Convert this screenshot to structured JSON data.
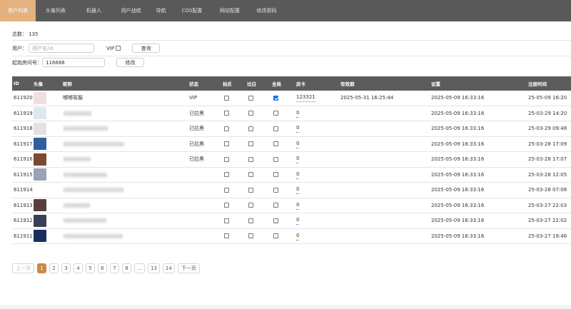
{
  "nav": [
    {
      "label": "用户列表",
      "active": true
    },
    {
      "label": "头像列表",
      "active": false
    },
    {
      "label": "机器人",
      "active": false
    },
    {
      "label": "用户战绩",
      "active": false
    },
    {
      "label": "导航",
      "active": false
    },
    {
      "label": "COS配置",
      "active": false
    },
    {
      "label": "网站配置",
      "active": false
    },
    {
      "label": "修改密码",
      "active": false
    }
  ],
  "summary": {
    "label": "总数：",
    "value": "135"
  },
  "search": {
    "user_label": "用户：",
    "placeholder": "用户名/id",
    "vip_label": "VIP",
    "query_button": "查询"
  },
  "start_room": {
    "label": "起始房间号：",
    "value": "116688",
    "modify_button": "修改"
  },
  "table": {
    "headers": [
      "ID",
      "头像",
      "昵称",
      "状态",
      "拍反",
      "过白",
      "全局",
      "房卡",
      "有效期",
      "设置",
      "注册时间"
    ],
    "rows": [
      {
        "id": "611920",
        "nickname": "嘟嘟客服",
        "status": "VIP",
        "f1": false,
        "f2": false,
        "f3": true,
        "card": "123321",
        "expiry": "2025-05-31 16:25:44",
        "setting": "2025-05-09 16:33:16",
        "registered": "25-05-09 16:20",
        "avatar": "#f1dede"
      },
      {
        "id": "611919",
        "nickname": "",
        "status": "已拉黑",
        "f1": false,
        "f2": false,
        "f3": false,
        "card": "0",
        "expiry": "",
        "setting": "2025-05-09 16:33:16",
        "registered": "25-03-29 14:20",
        "avatar": "#dce9ef"
      },
      {
        "id": "611918",
        "nickname": "",
        "status": "已拉黑",
        "f1": false,
        "f2": false,
        "f3": false,
        "card": "0",
        "expiry": "",
        "setting": "2025-05-09 16:33:16",
        "registered": "25-03-29 09:48",
        "avatar": "#e2e2e2"
      },
      {
        "id": "611917",
        "nickname": "",
        "status": "已拉黑",
        "f1": false,
        "f2": false,
        "f3": false,
        "card": "0",
        "expiry": "",
        "setting": "2025-05-09 16:33:16",
        "registered": "25-03-28 17:09",
        "avatar": "#2f5f9e"
      },
      {
        "id": "611916",
        "nickname": "",
        "status": "已拉黑",
        "f1": false,
        "f2": false,
        "f3": false,
        "card": "0",
        "expiry": "",
        "setting": "2025-05-09 16:33:16",
        "registered": "25-03-28 17:07",
        "avatar": "#7a4a2e"
      },
      {
        "id": "611915",
        "nickname": "",
        "status": "",
        "f1": false,
        "f2": false,
        "f3": false,
        "card": "0",
        "expiry": "",
        "setting": "2025-05-09 16:33:16",
        "registered": "25-03-28 12:05",
        "avatar": "#9aa3b5"
      },
      {
        "id": "611914",
        "nickname": "",
        "status": "",
        "f1": false,
        "f2": false,
        "f3": false,
        "card": "0",
        "expiry": "",
        "setting": "2025-05-09 16:33:16",
        "registered": "25-03-28 07:08",
        "avatar": "#ffffff"
      },
      {
        "id": "611913",
        "nickname": "",
        "status": "",
        "f1": false,
        "f2": false,
        "f3": false,
        "card": "0",
        "expiry": "",
        "setting": "2025-05-09 16:33:16",
        "registered": "25-03-27 22:03",
        "avatar": "#5a3e3e"
      },
      {
        "id": "611912",
        "nickname": "",
        "status": "",
        "f1": false,
        "f2": false,
        "f3": false,
        "card": "0",
        "expiry": "",
        "setting": "2025-05-09 16:33:16",
        "registered": "25-03-27 22:02",
        "avatar": "#3a3f57"
      },
      {
        "id": "611911",
        "nickname": "",
        "status": "",
        "f1": false,
        "f2": false,
        "f3": false,
        "card": "0",
        "expiry": "",
        "setting": "2025-05-09 16:33:16",
        "registered": "25-03-27 19:46",
        "avatar": "#1b2c5e"
      }
    ]
  },
  "pager": {
    "prev": "上一页",
    "next": "下一页",
    "pages": [
      "1",
      "2",
      "3",
      "4",
      "5",
      "6",
      "7",
      "8",
      "…",
      "13",
      "14"
    ],
    "current": "1"
  }
}
